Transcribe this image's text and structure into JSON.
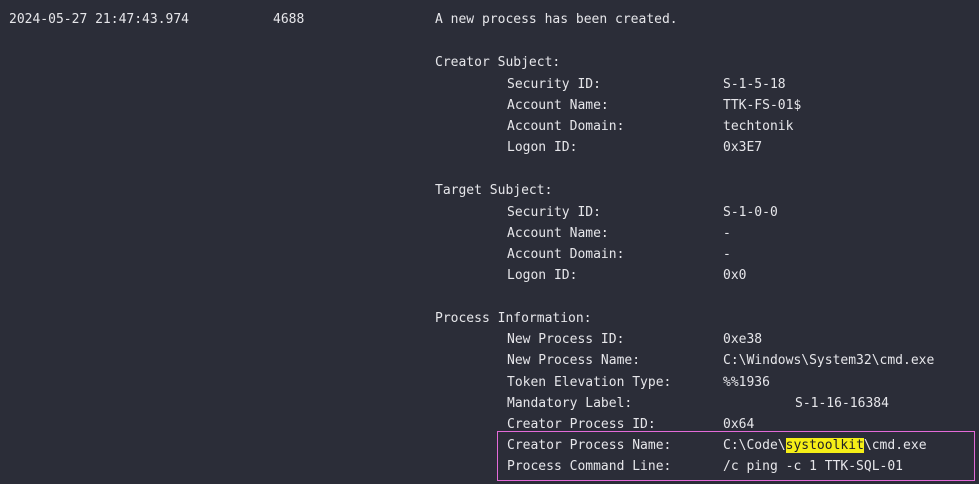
{
  "event": {
    "timestamp": "2024-05-27 21:47:43.974",
    "event_id": "4688",
    "message": "A new process has been created."
  },
  "creator_subject": {
    "header": "Creator Subject:",
    "security_id_label": "Security ID:",
    "security_id": "S-1-5-18",
    "account_name_label": "Account Name:",
    "account_name": "TTK-FS-01$",
    "account_domain_label": "Account Domain:",
    "account_domain": "techtonik",
    "logon_id_label": "Logon ID:",
    "logon_id": "0x3E7"
  },
  "target_subject": {
    "header": "Target Subject:",
    "security_id_label": "Security ID:",
    "security_id": "S-1-0-0",
    "account_name_label": "Account Name:",
    "account_name": "-",
    "account_domain_label": "Account Domain:",
    "account_domain": "-",
    "logon_id_label": "Logon ID:",
    "logon_id": "0x0"
  },
  "process_information": {
    "header": "Process Information:",
    "new_process_id_label": "New Process ID:",
    "new_process_id": "0xe38",
    "new_process_name_label": "New Process Name:",
    "new_process_name": "C:\\Windows\\System32\\cmd.exe",
    "token_elevation_type_label": "Token Elevation Type:",
    "token_elevation_type": "%%1936",
    "mandatory_label_label": "Mandatory Label:",
    "mandatory_label": "S-1-16-16384",
    "creator_process_id_label": "Creator Process ID:",
    "creator_process_id": "0x64",
    "creator_process_name_label": "Creator Process Name:",
    "creator_process_name_prefix": "C:\\Code\\",
    "creator_process_name_highlight": "systoolkit",
    "creator_process_name_suffix": "\\cmd.exe",
    "process_command_line_label": "Process Command Line:",
    "process_command_line": "/c ping -c 1 TTK-SQL-01"
  },
  "colors": {
    "background": "#2b2d38",
    "text": "#e6e6ea",
    "highlight": "#f5ee17",
    "box_border": "#e36ad8"
  }
}
